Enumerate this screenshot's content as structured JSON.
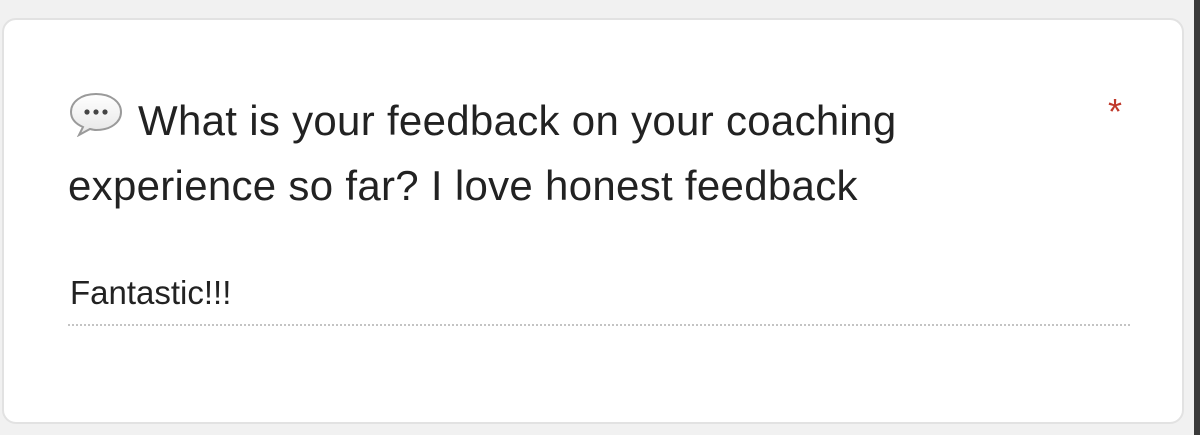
{
  "question": {
    "icon": "speech-bubble-icon",
    "text": "What is your feedback on your coaching experience so far? I love honest feedback",
    "required_marker": "*"
  },
  "answer": {
    "value": "Fantastic!!!"
  },
  "colors": {
    "required": "#c0392b",
    "text": "#222222",
    "card_background": "#ffffff",
    "page_background": "#f1f1f1"
  }
}
